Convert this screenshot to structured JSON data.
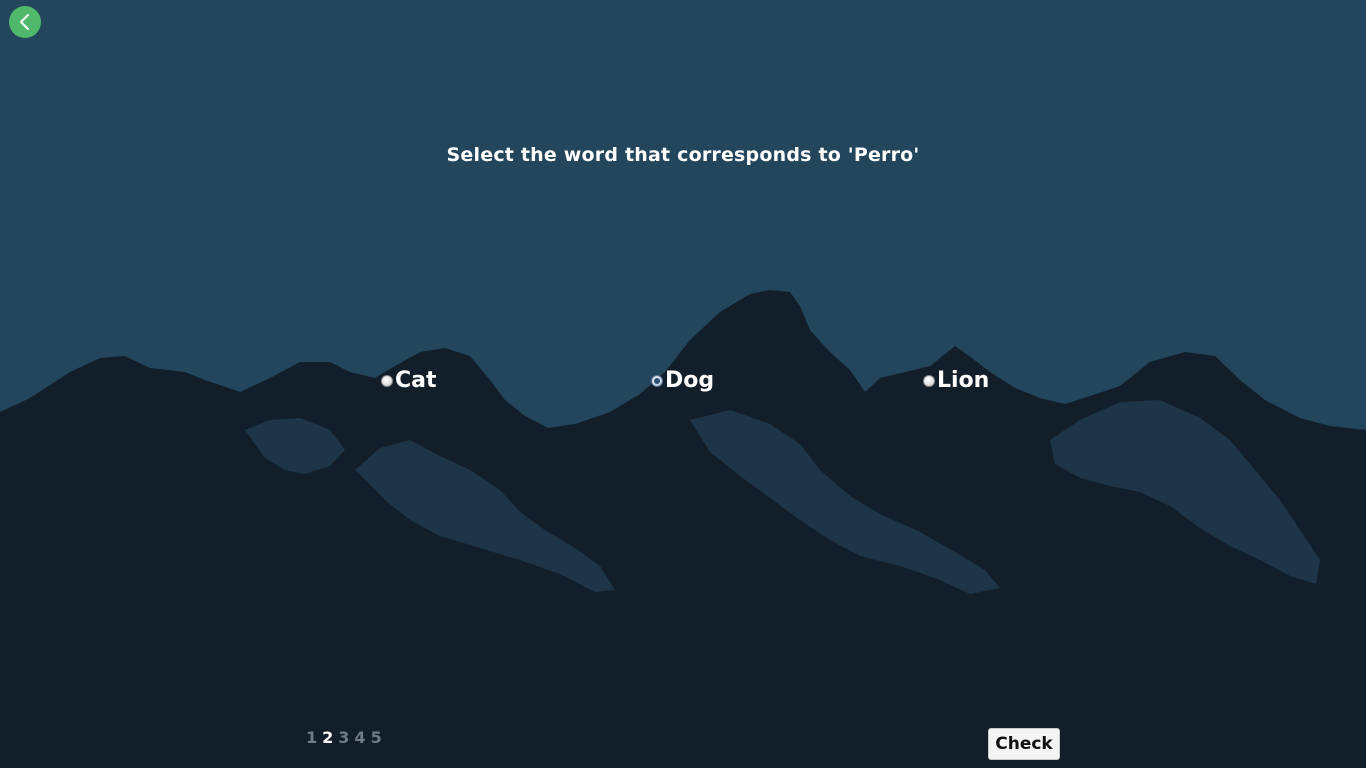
{
  "quiz": {
    "question": "Select the word that corresponds to 'Perro'",
    "options": [
      {
        "label": "Cat",
        "selected": false
      },
      {
        "label": "Dog",
        "selected": true
      },
      {
        "label": "Lion",
        "selected": false
      }
    ]
  },
  "navigation": {
    "back_icon": "chevron-left-icon",
    "pages": [
      "1",
      "2",
      "3",
      "4",
      "5"
    ],
    "current_page": "2"
  },
  "actions": {
    "check_label": "Check"
  },
  "colors": {
    "sky": "#23465c",
    "mountain_dark": "#121f2a",
    "mountain_snow": "#1d3547",
    "back_button": "#4fb86b",
    "text": "#ffffff",
    "pager_inactive": "#6d7d88"
  }
}
